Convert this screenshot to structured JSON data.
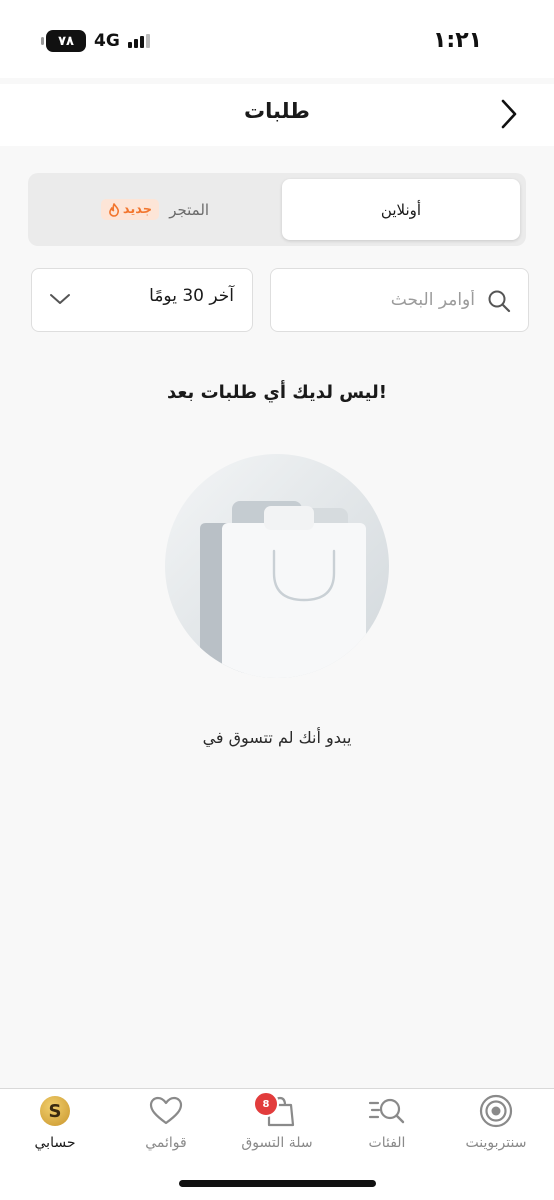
{
  "status_bar": {
    "time": "١:٢١",
    "network": "4G",
    "battery": "٧٨"
  },
  "header": {
    "title": "طلبات"
  },
  "tabs": {
    "online_label": "أونلاين",
    "store_label": "المتجر",
    "new_badge": "جديد",
    "active": "online"
  },
  "filters": {
    "date_range": "آخر 30 يومًا",
    "search_placeholder": "أوامر البحث"
  },
  "empty_state": {
    "title": "ليس لديك أي طلبات بعد!",
    "subtitle": "يبدو أنك لم تتسوق في"
  },
  "bottom_nav": {
    "items": [
      {
        "label": "سنتربوينت",
        "icon": "target-icon"
      },
      {
        "label": "الفئات",
        "icon": "categories-search-icon"
      },
      {
        "label": "سلة التسوق",
        "icon": "shopping-bag-icon",
        "badge": "8"
      },
      {
        "label": "قوائمي",
        "icon": "heart-icon"
      },
      {
        "label": "حسابي",
        "icon": "avatar-icon",
        "avatar_letter": "S",
        "active": true
      }
    ]
  },
  "colors": {
    "accent_orange": "#f2762e",
    "badge_red": "#e23c3c",
    "background": "#f8f8f8"
  }
}
